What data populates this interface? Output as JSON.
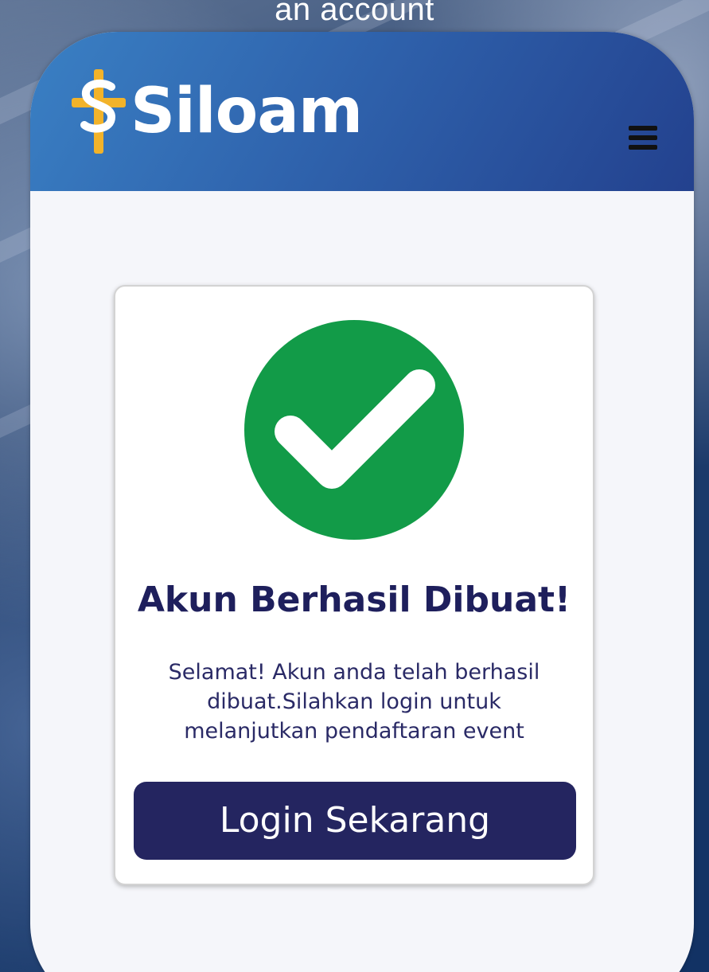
{
  "caption": {
    "text": "an account"
  },
  "header": {
    "logo_text": "Siloam",
    "logo_icon": "siloam-cross-icon",
    "menu_icon": "hamburger-menu-icon",
    "background_colors": [
      "#3a80c4",
      "#23418e"
    ]
  },
  "success_card": {
    "status_icon": "check-circle-icon",
    "status_color": "#129b48",
    "title": "Akun Berhasil Dibuat!",
    "message_lines": [
      "Selamat! Akun anda telah berhasil",
      "dibuat.Silahkan login untuk",
      "melanjutkan pendaftaran event"
    ],
    "login_button_label": "Login Sekarang",
    "login_button_color": "#242560",
    "title_color": "#1e1f5c"
  }
}
